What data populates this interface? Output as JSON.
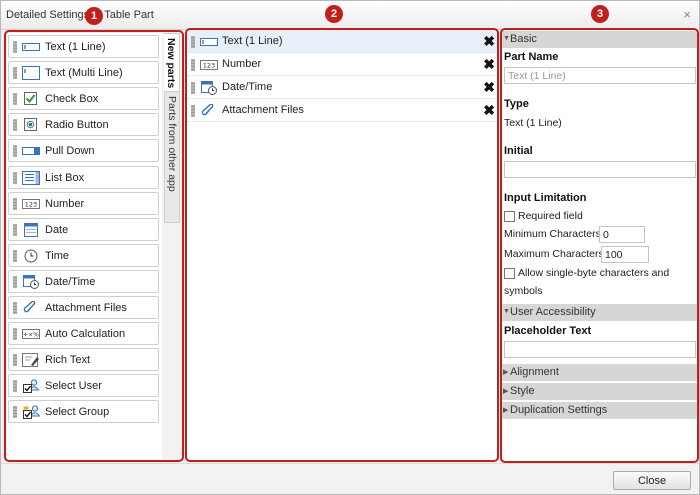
{
  "dialog": {
    "title": "Detailed Settings of Table Part",
    "close_label": "×"
  },
  "badges": {
    "panel1": "1",
    "panel2": "2",
    "panel3": "3"
  },
  "palette": {
    "items": [
      {
        "label": "Text (1 Line)",
        "icon": "text-line-icon"
      },
      {
        "label": "Text (Multi Line)",
        "icon": "text-multiline-icon"
      },
      {
        "label": "Check Box",
        "icon": "checkbox-icon"
      },
      {
        "label": "Radio Button",
        "icon": "radio-button-icon"
      },
      {
        "label": "Pull Down",
        "icon": "pulldown-icon"
      },
      {
        "label": "List Box",
        "icon": "listbox-icon"
      },
      {
        "label": "Number",
        "icon": "number-icon"
      },
      {
        "label": "Date",
        "icon": "calendar-icon"
      },
      {
        "label": "Time",
        "icon": "clock-icon"
      },
      {
        "label": "Date/Time",
        "icon": "datetime-icon"
      },
      {
        "label": "Attachment Files",
        "icon": "paperclip-icon"
      },
      {
        "label": "Auto Calculation",
        "icon": "calculation-icon"
      },
      {
        "label": "Rich Text",
        "icon": "richtext-icon"
      },
      {
        "label": "Select User",
        "icon": "select-user-icon"
      },
      {
        "label": "Select Group",
        "icon": "select-group-icon"
      }
    ],
    "tabs": [
      {
        "label": "New parts",
        "active": true
      },
      {
        "label": "Parts from other app",
        "active": false
      }
    ]
  },
  "canvas": {
    "rows": [
      {
        "label": "Text (1 Line)",
        "icon": "text-line-icon",
        "selected": true
      },
      {
        "label": "Number",
        "icon": "number-icon",
        "selected": false
      },
      {
        "label": "Date/Time",
        "icon": "datetime-icon",
        "selected": false
      },
      {
        "label": "Attachment Files",
        "icon": "paperclip-icon",
        "selected": false
      }
    ],
    "delete_label": "✖"
  },
  "properties": {
    "basic": {
      "header": "Basic",
      "part_name_label": "Part Name",
      "part_name_placeholder": "Text (1 Line)",
      "type_label": "Type",
      "type_value": "Text (1 Line)",
      "initial_label": "Initial",
      "initial_value": "",
      "input_limitation_label": "Input Limitation",
      "required_label": "Required field",
      "min_chars_label": "Minimum Characters",
      "min_chars_value": "0",
      "max_chars_label": "Maximum Characters",
      "max_chars_value": "100",
      "single_byte_label_1": "Allow single-byte characters and",
      "single_byte_label_2": "symbols"
    },
    "user_accessibility": {
      "header": "User Accessibility",
      "placeholder_label": "Placeholder Text",
      "placeholder_value": ""
    },
    "collapsed_sections": [
      "Alignment",
      "Style",
      "Duplication Settings"
    ]
  },
  "footer": {
    "close_label": "Close"
  },
  "colors": {
    "highlight_border": "#c0201c",
    "section_header": "#d6d6d6",
    "selected_row": "#e8eff8",
    "checkbox_green": "#2a9d3a",
    "icon_blue": "#3b73b9"
  }
}
